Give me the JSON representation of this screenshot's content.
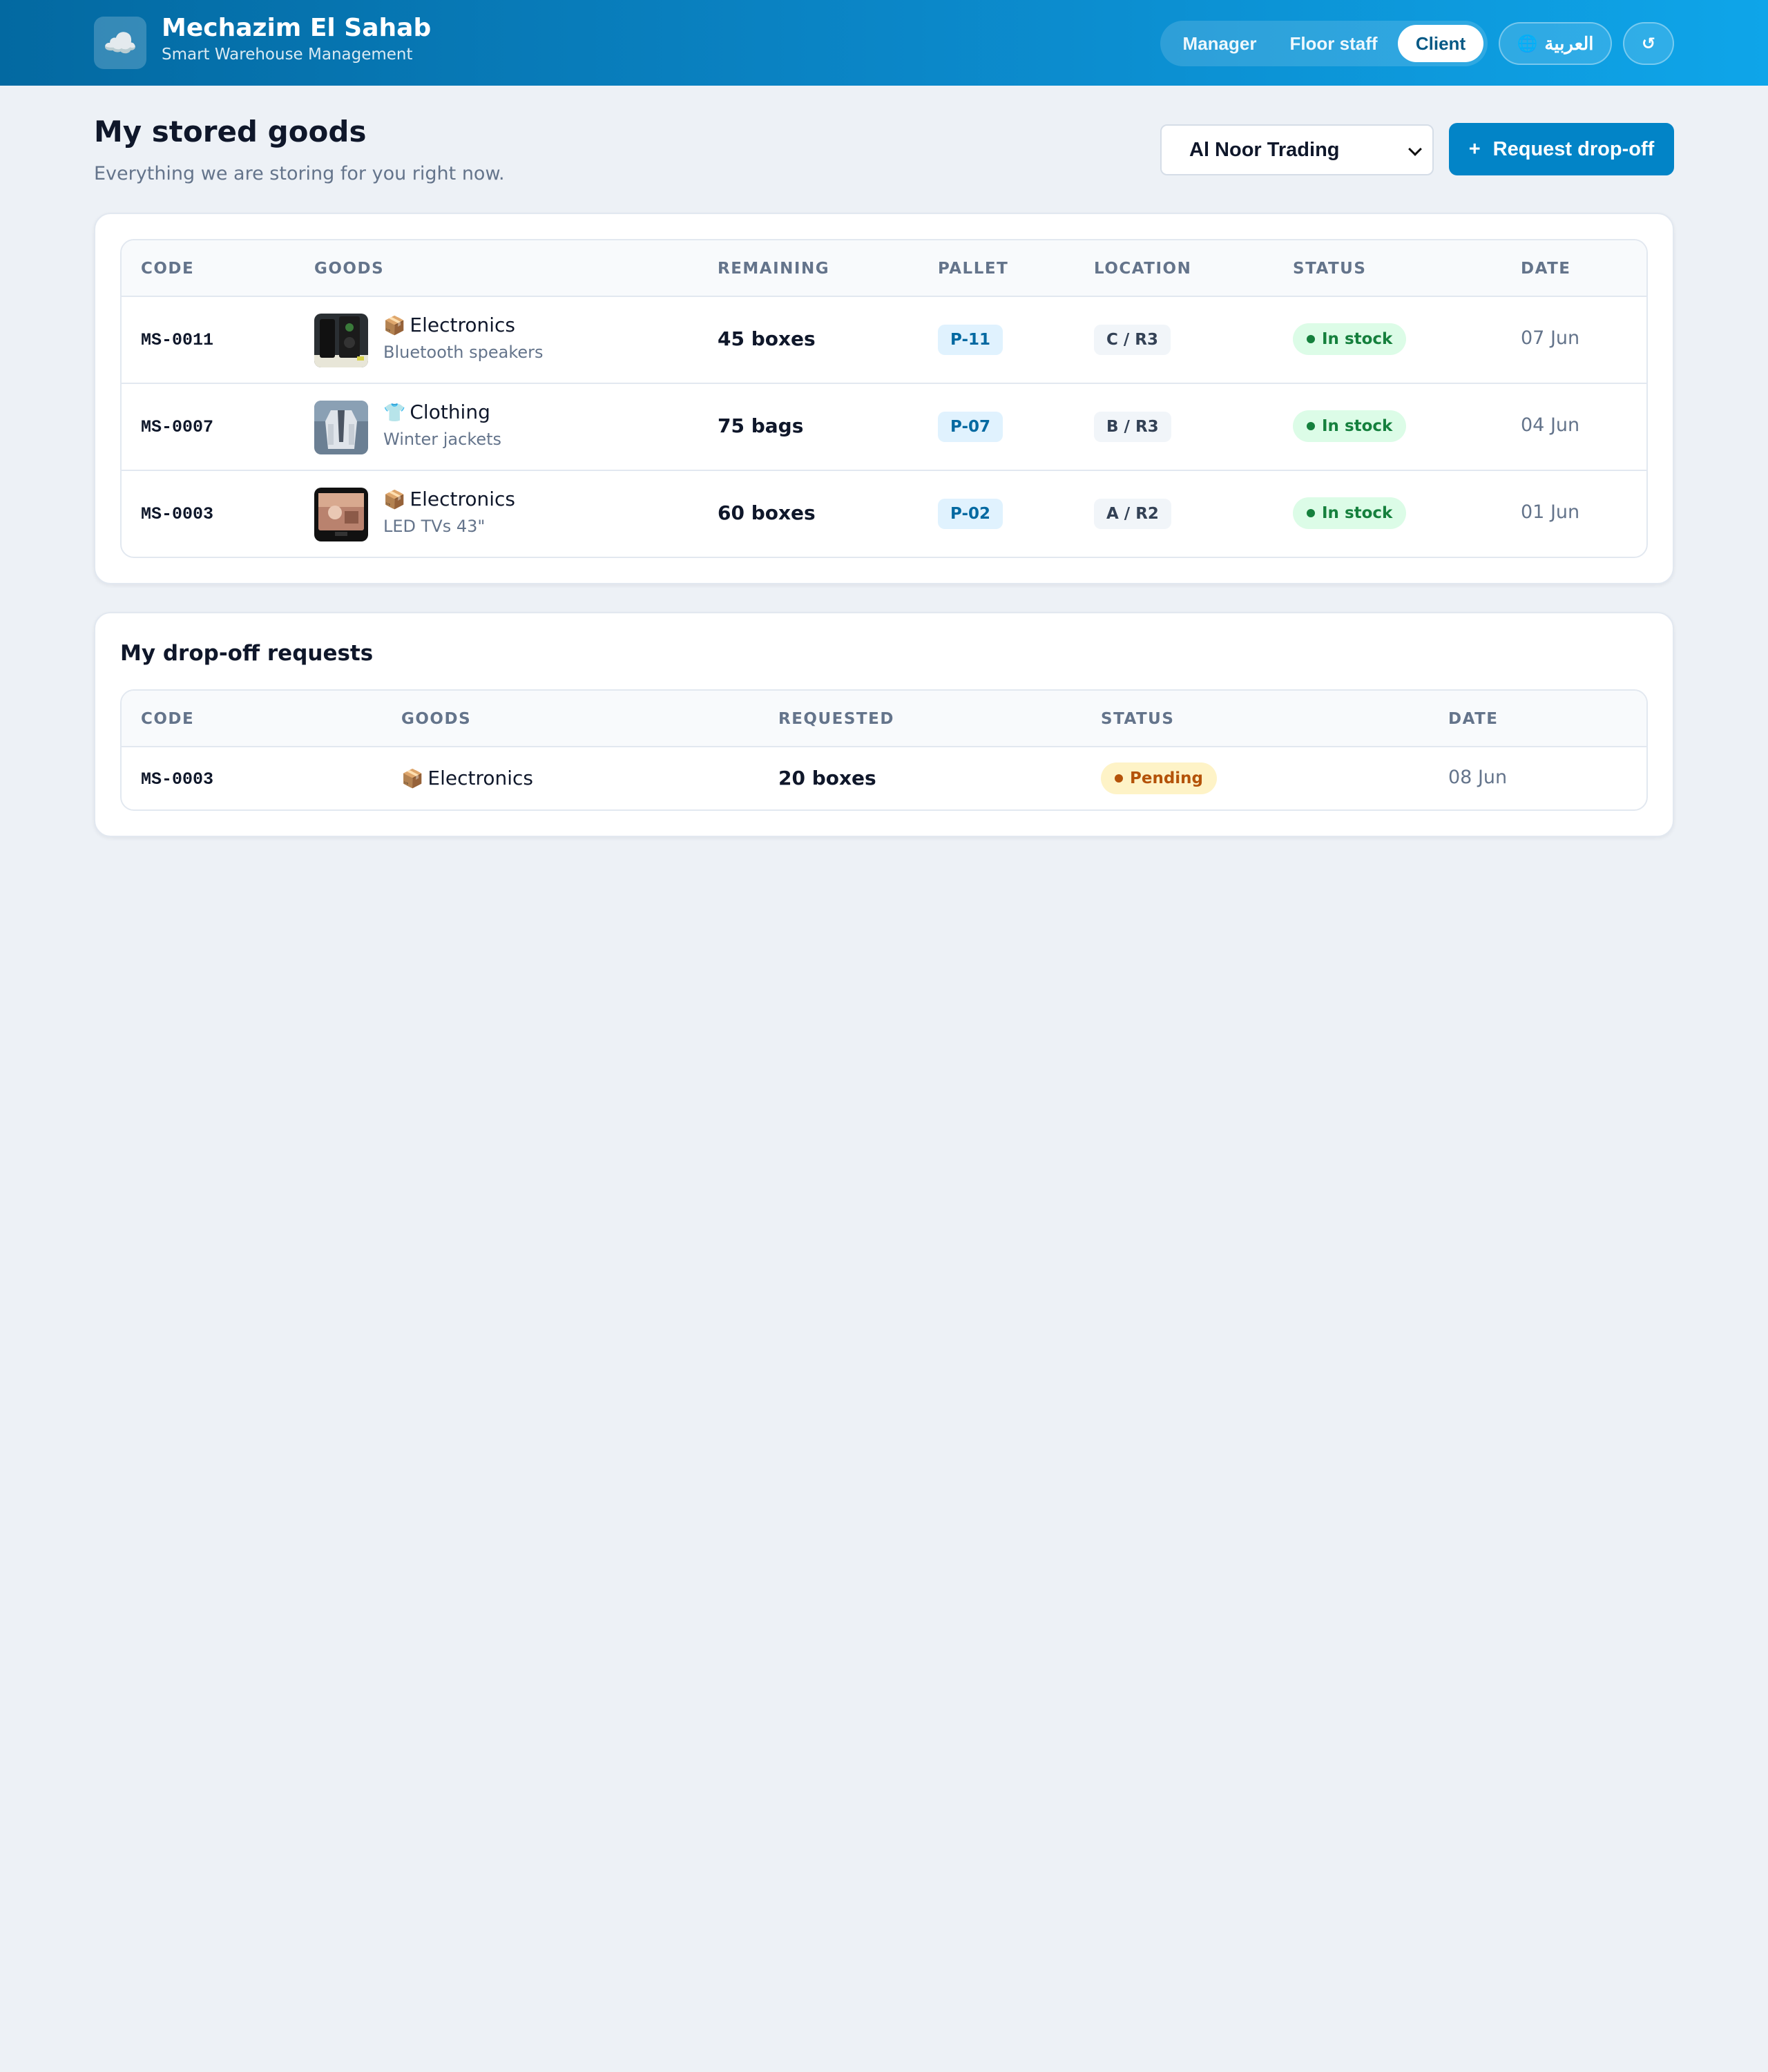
{
  "header": {
    "brand_name": "Mechazim El Sahab",
    "brand_sub": "Smart Warehouse Management",
    "logo_icon": "☁️",
    "roles": [
      {
        "label": "Manager",
        "active": false
      },
      {
        "label": "Floor staff",
        "active": false
      },
      {
        "label": "Client",
        "active": true
      }
    ],
    "language_label": "العربية",
    "language_icon": "🌐",
    "reset_icon": "↺"
  },
  "page": {
    "title": "My stored goods",
    "subtitle": "Everything we are storing for you right now.",
    "client_select_value": "Al Noor Trading",
    "request_button_icon": "+",
    "request_button_label": "Request drop-off"
  },
  "stored": {
    "columns": [
      "CODE",
      "GOODS",
      "REMAINING",
      "PALLET",
      "LOCATION",
      "STATUS",
      "DATE"
    ],
    "rows": [
      {
        "code": "MS-0011",
        "category_icon": "📦",
        "category": "Electronics",
        "item": "Bluetooth speakers",
        "remaining": "45 boxes",
        "pallet": "P-11",
        "location": "C / R3",
        "status": "In stock",
        "date": "07 Jun"
      },
      {
        "code": "MS-0007",
        "category_icon": "👕",
        "category": "Clothing",
        "item": "Winter jackets",
        "remaining": "75 bags",
        "pallet": "P-07",
        "location": "B / R3",
        "status": "In stock",
        "date": "04 Jun"
      },
      {
        "code": "MS-0003",
        "category_icon": "📦",
        "category": "Electronics",
        "item": "LED TVs 43\"",
        "remaining": "60 boxes",
        "pallet": "P-02",
        "location": "A / R2",
        "status": "In stock",
        "date": "01 Jun"
      }
    ]
  },
  "requests": {
    "title": "My drop-off requests",
    "columns": [
      "CODE",
      "GOODS",
      "REQUESTED",
      "STATUS",
      "DATE"
    ],
    "rows": [
      {
        "code": "MS-0003",
        "category_icon": "📦",
        "category": "Electronics",
        "requested": "20 boxes",
        "status": "Pending",
        "date": "08 Jun"
      }
    ]
  },
  "colors": {
    "brand": "#0284c7",
    "in_stock": "#15803d",
    "pending": "#b45309"
  }
}
